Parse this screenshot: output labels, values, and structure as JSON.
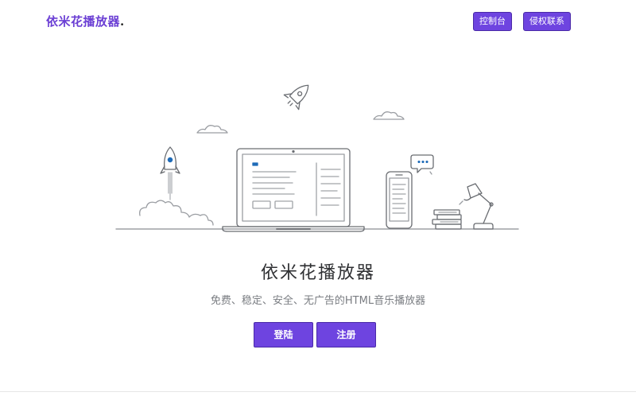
{
  "brand": {
    "name": "依米花播放器",
    "suffix": "."
  },
  "nav": {
    "items": [
      {
        "label": "控制台"
      },
      {
        "label": "侵权联系"
      }
    ]
  },
  "hero": {
    "title": "依米花播放器",
    "subtitle": "免费、稳定、安全、无广告的HTML音乐播放器"
  },
  "actions": {
    "login_label": "登陆",
    "register_label": "注册"
  },
  "colors": {
    "accent": "#6e44e0",
    "brand_text": "#6b3fd4",
    "line_art": "#6a6d72",
    "highlight": "#1e6bb8"
  },
  "icons": {
    "illustration": "workspace-illustration",
    "rocket": "rocket-icon",
    "laptop": "laptop-icon",
    "phone": "phone-icon",
    "chat": "chat-bubble-icon",
    "lamp": "desk-lamp-icon",
    "books": "books-icon",
    "clouds": "cloud-icon"
  }
}
